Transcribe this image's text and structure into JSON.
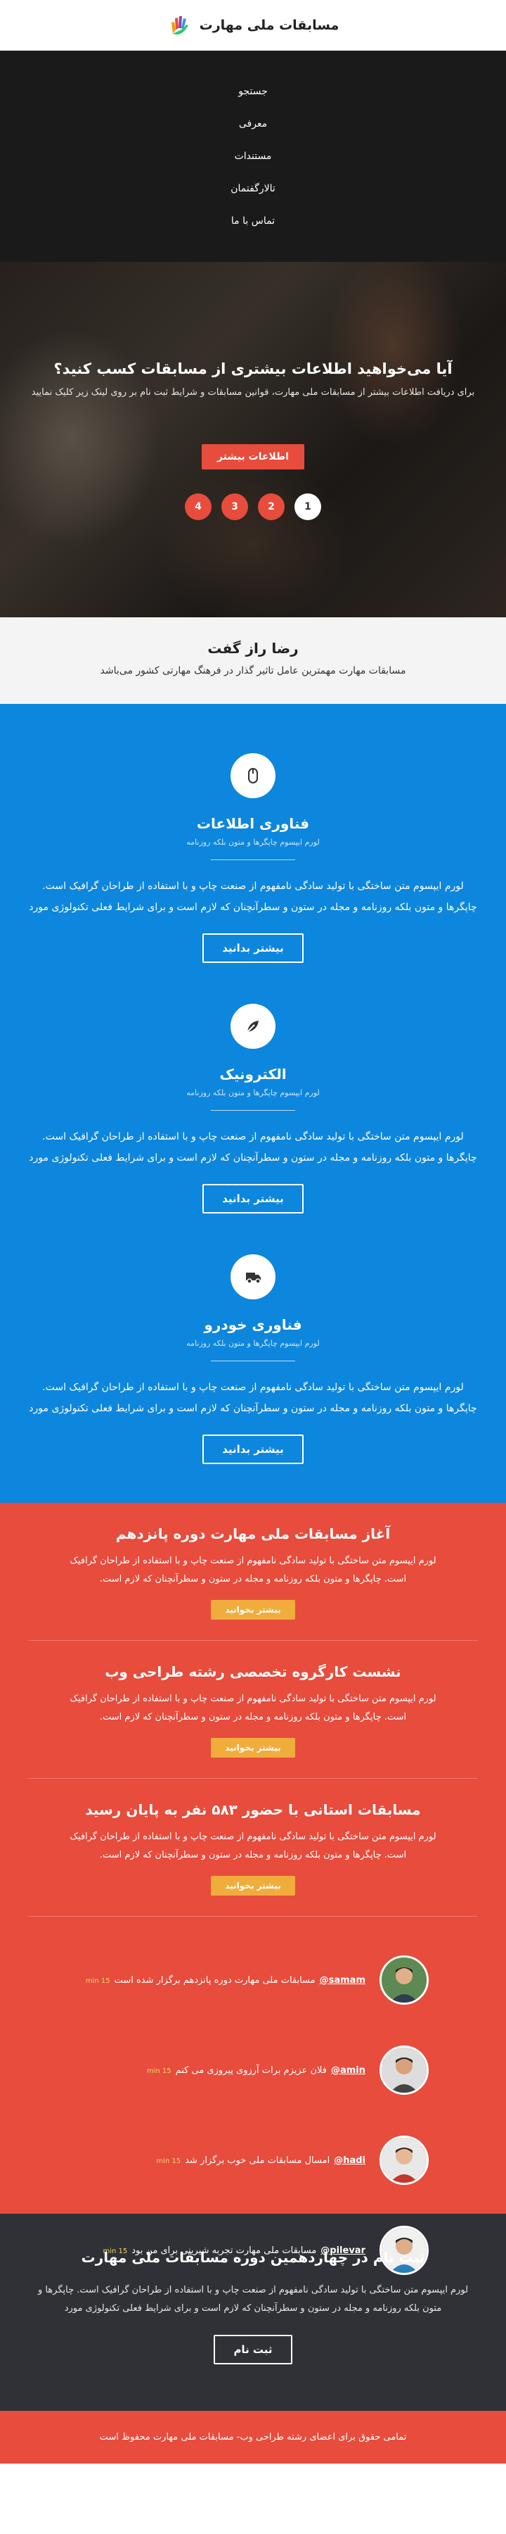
{
  "header": {
    "title": "مسابقات ملی مهارت",
    "logo_icon": "hand-logo-icon"
  },
  "nav": {
    "items": [
      {
        "label": "جستجو"
      },
      {
        "label": "معرفی"
      },
      {
        "label": "مستندات"
      },
      {
        "label": "تالارگفتمان"
      },
      {
        "label": "تماس با ما"
      }
    ]
  },
  "hero": {
    "title": "آیا می‌خواهید اطلاعات بیشتری از مسابقات کسب کنید؟",
    "subtitle": "برای دریافت اطلاعات بیشتر از مسابقات ملی مهارت، قوانین مسابقات و شرایط ثبت نام بر روی لینک زیر کلیک نمایید",
    "button": "اطلاعات بیشتر",
    "pager": [
      "1",
      "2",
      "3",
      "4"
    ],
    "active_page": "1"
  },
  "quote": {
    "title": "رضا راز گفت",
    "subtitle": "مسابقات مهارت مهمترین عامل تاثیر گذار در فرهنگ مهارتی کشور می‌باشد"
  },
  "services": [
    {
      "icon": "mouse-icon",
      "title": "فناوری اطلاعات",
      "sub": "لورم ایپسوم چاپگرها و متون بلکه روزنامه",
      "body": "لورم ایپسوم متن ساختگی با تولید سادگی نامفهوم از صنعت چاپ و با استفاده از طراحان گرافیک است. چاپگرها و متون بلکه روزنامه و مجله در ستون و سطرآنچنان که لازم است و برای شرایط فعلی تکنولوژی مورد",
      "button": "بیشتر بدانید"
    },
    {
      "icon": "leaf-icon",
      "title": "الکترونیک",
      "sub": "لورم ایپسوم چاپگرها و متون بلکه روزنامه",
      "body": "لورم ایپسوم متن ساختگی با تولید سادگی نامفهوم از صنعت چاپ و با استفاده از طراحان گرافیک است. چاپگرها و متون بلکه روزنامه و مجله در ستون و سطرآنچنان که لازم است و برای شرایط فعلی تکنولوژی مورد",
      "button": "بیشتر بدانید"
    },
    {
      "icon": "truck-icon",
      "title": "فناوری خودرو",
      "sub": "لورم ایپسوم چاپگرها و متون بلکه روزنامه",
      "body": "لورم ایپسوم متن ساختگی با تولید سادگی نامفهوم از صنعت چاپ و با استفاده از طراحان گرافیک است. چاپگرها و متون بلکه روزنامه و مجله در ستون و سطرآنچنان که لازم است و برای شرایط فعلی تکنولوژی مورد",
      "button": "بیشتر بدانید"
    }
  ],
  "news": [
    {
      "title": "آغاز مسابقات ملی مهارت دوره پانزدهم",
      "body": "لورم ایپسوم متن ساختگی با تولید سادگی نامفهوم از صنعت چاپ و با استفاده از طراحان گرافیک است. چاپگرها و متون بلکه روزنامه و مجله در ستون و سطرآنچنان که لازم است.",
      "button": "بیشتر بخوانید"
    },
    {
      "title": "نشست کارگروه تخصصی رشته طراحی وب",
      "body": "لورم ایپسوم متن ساختگی با تولید سادگی نامفهوم از صنعت چاپ و با استفاده از طراحان گرافیک است. چاپگرها و متون بلکه روزنامه و مجله در ستون و سطرآنچنان که لازم است.",
      "button": "بیشتر بخوانید"
    },
    {
      "title": "مسابقات استانی با حضور ۵۸۳ نفر به پایان رسید",
      "body": "لورم ایپسوم متن ساختگی با تولید سادگی نامفهوم از صنعت چاپ و با استفاده از طراحان گرافیک است. چاپگرها و متون بلکه روزنامه و مجله در ستون و سطرآنچنان که لازم است.",
      "button": "بیشتر بخوانید"
    }
  ],
  "comments": [
    {
      "user": "samam@",
      "text": "مسابقات ملی مهارت دوره پانزدهم برگزار شده است",
      "time": "min 15"
    },
    {
      "user": "amin@",
      "text": "فلان عزیزم برات آرزوی پیروزی می کنم",
      "time": "min 15"
    },
    {
      "user": "hadi@",
      "text": "امسال مسابقات ملی خوب برگزار شد",
      "time": "min 15"
    },
    {
      "user": "pilevar@",
      "text": "مسابقات ملی مهارت تجربه شیرینی برای من بود",
      "time": "min 15"
    }
  ],
  "register": {
    "title": "ثبت نام در چهاردهمین دوره مسابقات ملی مهارت",
    "body": "لورم ایپسوم متن ساختگی با تولید سادگی نامفهوم از صنعت چاپ و با استفاده از طراحان گرافیک است. چاپگرها و متون بلکه روزنامه و مجله در ستون و سطرآنچنان که لازم است و برای شرایط فعلی تکنولوژی مورد",
    "button": "ثبت نام"
  },
  "footer": {
    "text": "تمامی حقوق برای اعضای رشته طراحی وب- مسابقات ملی مهارت محفوظ است"
  },
  "colors": {
    "blue": "#0d86dd",
    "red": "#e74c3c",
    "orange": "#f0ad3c",
    "dark": "#2f3136",
    "nav": "#1a1a1a"
  }
}
